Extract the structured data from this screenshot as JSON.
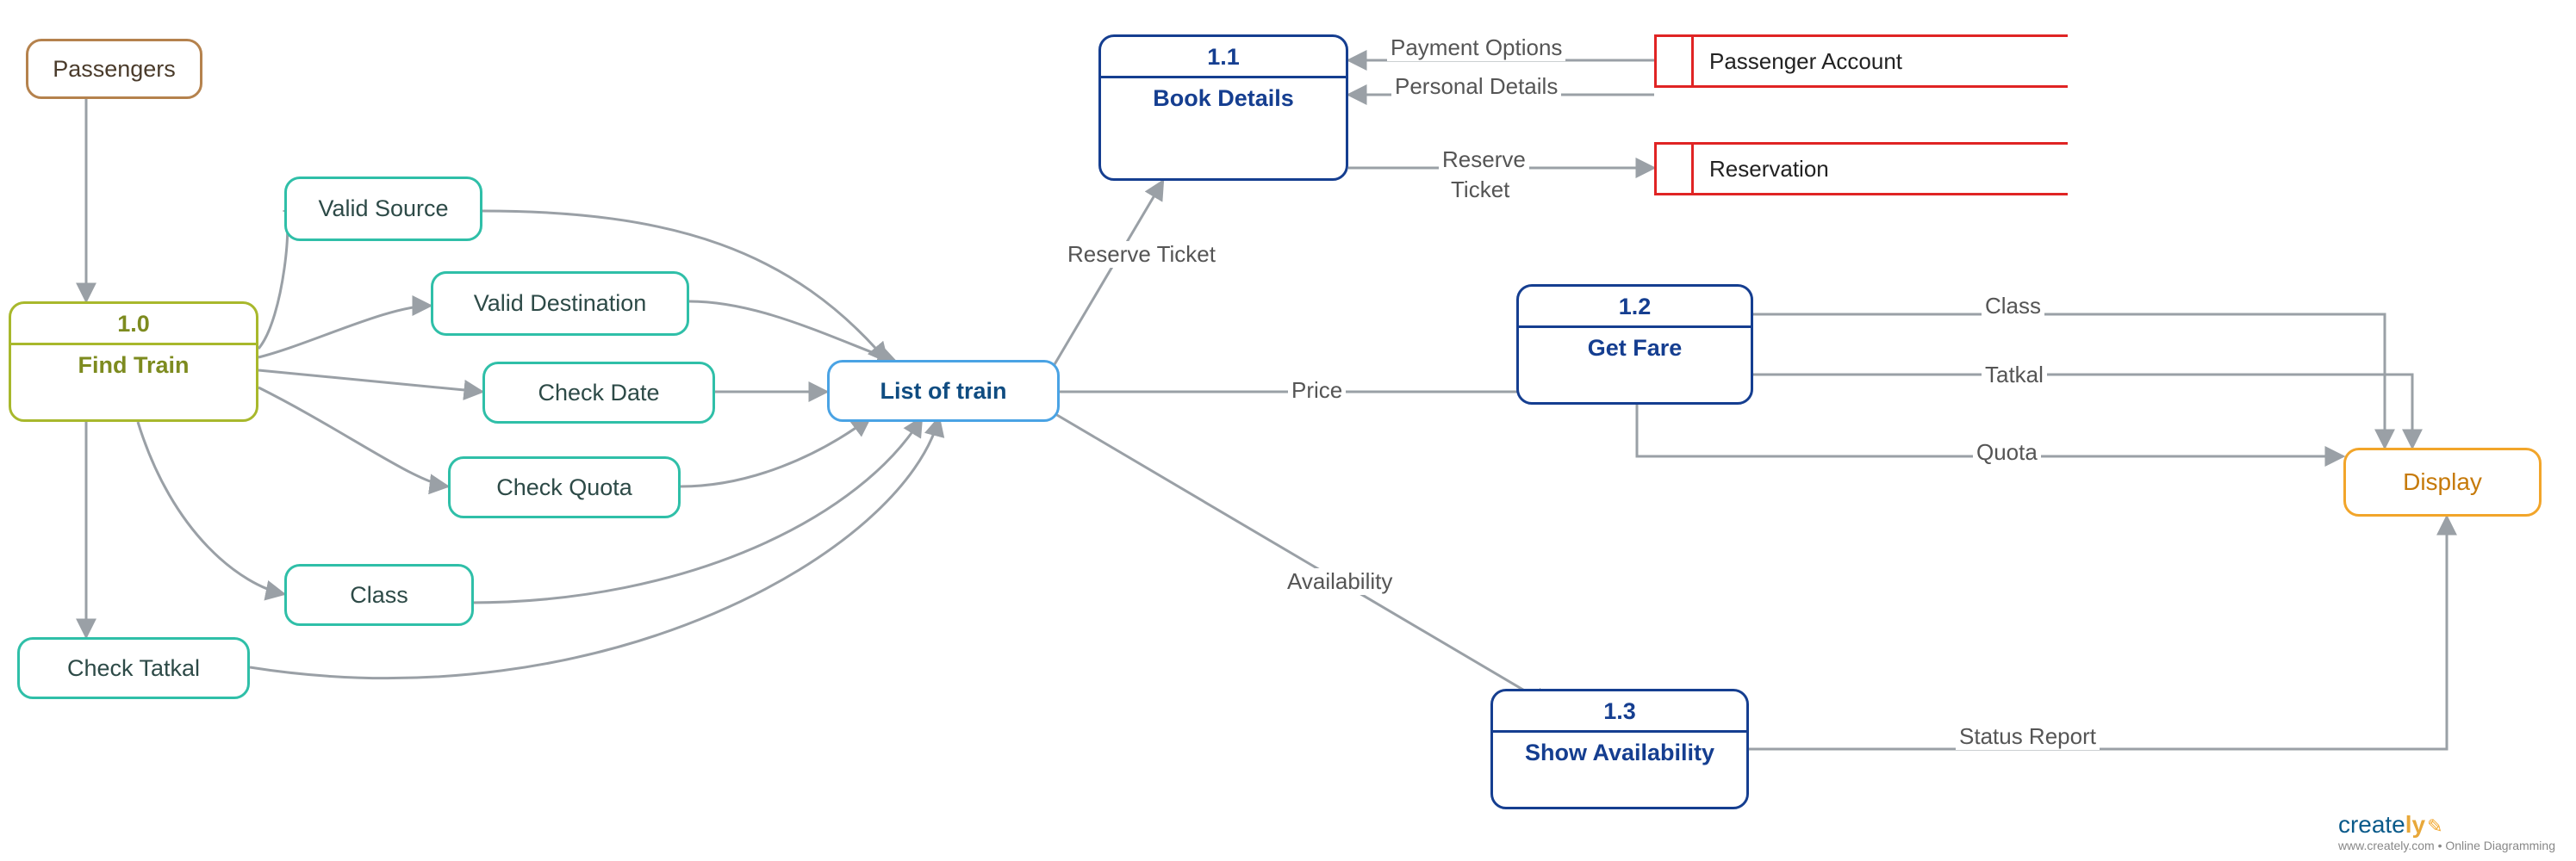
{
  "nodes": {
    "passengers": "Passengers",
    "findTrain": {
      "num": "1.0",
      "title": "Find Train"
    },
    "validSource": "Valid Source",
    "validDestination": "Valid Destination",
    "checkDate": "Check Date",
    "checkQuota": "Check Quota",
    "classNode": "Class",
    "checkTatkal": "Check Tatkal",
    "listOfTrain": "List of train",
    "bookDetails": {
      "num": "1.1",
      "title": "Book Details"
    },
    "getFare": {
      "num": "1.2",
      "title": "Get Fare"
    },
    "showAvailability": {
      "num": "1.3",
      "title": "Show Availability"
    },
    "display": "Display",
    "passengerAccount": "Passenger Account",
    "reservation": "Reservation"
  },
  "edges": {
    "reserveTicket": "Reserve Ticket",
    "price": "Price",
    "availability": "Availability",
    "paymentOptions": "Payment Options",
    "personalDetails": "Personal Details",
    "reserve": "Reserve",
    "ticket": "Ticket",
    "classLabel": "Class",
    "tatkal": "Tatkal",
    "quota": "Quota",
    "statusReport": "Status Report"
  },
  "footer": {
    "brand1": "create",
    "brand2": "ly",
    "sub": "www.creately.com • Online Diagramming"
  }
}
